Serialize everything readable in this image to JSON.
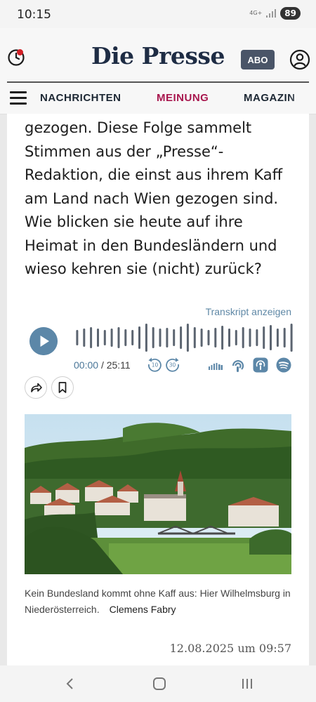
{
  "status_bar": {
    "time": "10:15",
    "network": "4G+",
    "battery": "89"
  },
  "header": {
    "logo": "Die Presse",
    "abo_label": "ABO",
    "nav": [
      "NACHRICHTEN",
      "MEINUNG",
      "MAGAZIN"
    ],
    "active_nav": "MEINUNG",
    "colors": {
      "brand": "#1e2c44",
      "active_nav": "#a8174e",
      "notification_dot": "#d32027"
    }
  },
  "article": {
    "body_lines": [
      "gezogen. Diese Folge sammelt",
      "Stimmen aus der „Presse“-",
      "Redaktion, die einst aus ihrem Kaff",
      "am Land nach Wien gezogen sind.",
      "Wie blicken sie heute auf ihre",
      "Heimat in den Bundesländern und",
      "wieso kehren sie (nicht) zurück?"
    ],
    "transcript_link": "Transkript anzeigen",
    "player": {
      "current_time": "00:00",
      "separator": "/",
      "duration": "25:11",
      "skip_back": "10",
      "skip_forward": "30",
      "progress": 0,
      "accent_color": "#5c87a8"
    },
    "caption": "Kein Bundesland kommt ohne Kaff aus: Hier Wilhelmsburg in Niederösterreich.",
    "credit": "Clemens Fabry",
    "date": "12.08.2025 um 09:57"
  }
}
